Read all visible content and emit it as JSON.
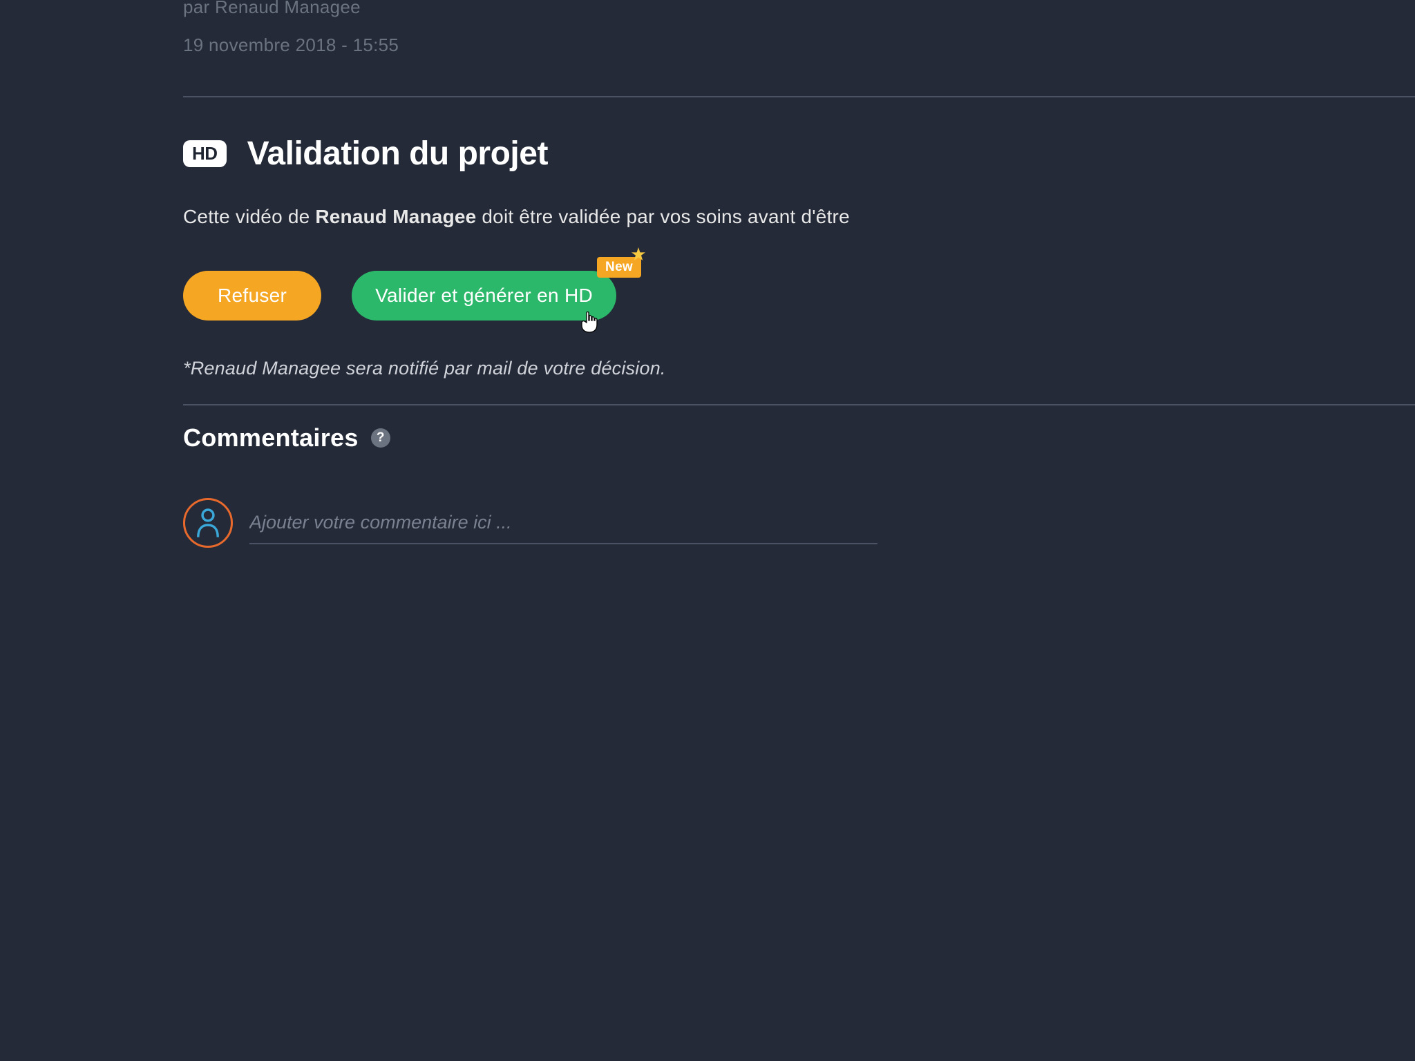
{
  "meta": {
    "author_prefix": "par ",
    "author_name": "Renaud Managee",
    "timestamp": "19 novembre 2018 - 15:55"
  },
  "validation": {
    "hd_label": "HD",
    "title": "Validation du projet",
    "description_prefix": "Cette vidéo de ",
    "description_bold": "Renaud Managee",
    "description_suffix": " doit être validée par vos soins avant d'être",
    "refuse_label": "Refuser",
    "validate_label": "Valider et générer en HD",
    "new_badge": "New",
    "notification_note": "*Renaud Managee sera notifié par mail de votre décision."
  },
  "comments": {
    "title": "Commentaires",
    "help_label": "?",
    "input_placeholder": "Ajouter votre commentaire ici ..."
  },
  "colors": {
    "background": "#242a38",
    "accent_orange": "#f5a623",
    "accent_green": "#2cb86a",
    "avatar_border": "#e8692c",
    "avatar_icon": "#3aa8d8"
  }
}
